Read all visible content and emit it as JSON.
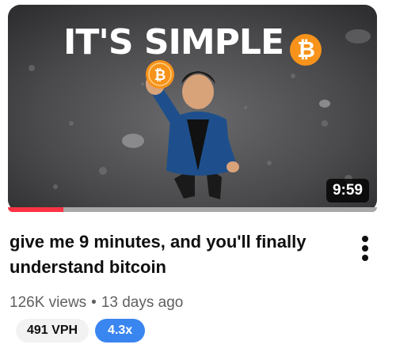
{
  "video": {
    "thumbnail": {
      "headline": "IT'S SIMPLE",
      "headline_icon": "bitcoin-icon",
      "coin_symbol": "₿",
      "duration": "9:59"
    },
    "watch_progress": 0.15,
    "title": "give me 9 minutes, and you'll finally understand bitcoin",
    "views": "126K views",
    "separator": "•",
    "age": "13 days ago",
    "menu_icon": "more-vertical-icon"
  },
  "badges": {
    "vph": "491 VPH",
    "ratio": "4.3x"
  },
  "colors": {
    "progress": "#ff3344",
    "bitcoin": "#f7931a",
    "ratio_badge": "#3a86f0"
  }
}
